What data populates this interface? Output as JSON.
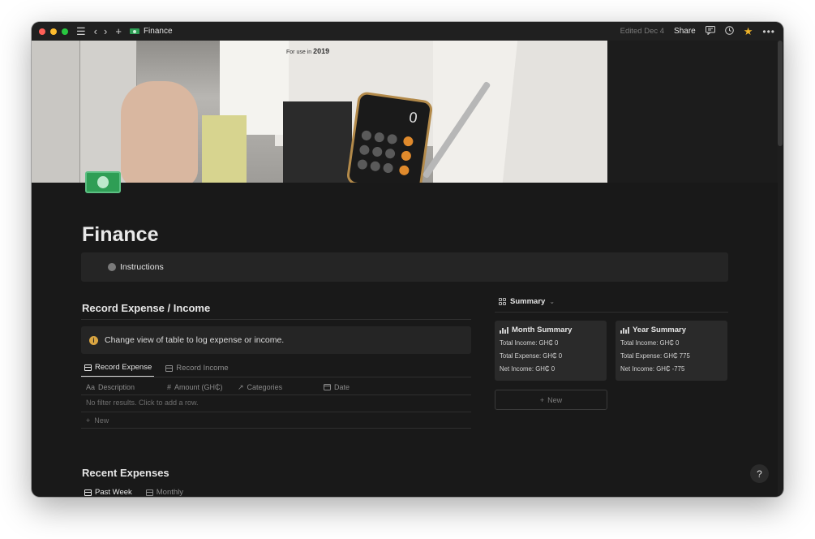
{
  "titlebar": {
    "page_name": "Finance",
    "edited": "Edited Dec 4",
    "share": "Share"
  },
  "cover": {
    "form_text": "For use in",
    "form_year": "2019",
    "calculator_display": "0"
  },
  "page": {
    "title": "Finance",
    "instructions_label": "Instructions"
  },
  "record_section": {
    "heading": "Record Expense / Income",
    "callout": "Change view of table to log expense or income.",
    "tabs": [
      {
        "label": "Record Expense",
        "active": true
      },
      {
        "label": "Record Income",
        "active": false
      }
    ],
    "columns": [
      {
        "icon": "Aa",
        "label": "Description"
      },
      {
        "icon": "#",
        "label": "Amount (GH₵)"
      },
      {
        "icon": "↗",
        "label": "Categories"
      },
      {
        "icon": "calendar-icon",
        "label": "Date"
      }
    ],
    "empty_text": "No filter results. Click to add a row.",
    "new_row": "New"
  },
  "summary": {
    "view_label": "Summary",
    "cards": [
      {
        "title": "Month Summary",
        "lines": [
          "Total Income: GH₵ 0",
          "Total Expense: GH₵ 0",
          "Net Income: GH₵ 0"
        ]
      },
      {
        "title": "Year Summary",
        "lines": [
          "Total Income: GH₵ 0",
          "Total Expense: GH₵ 775",
          "Net Income: GH₵ -775"
        ]
      }
    ],
    "new_label": "New"
  },
  "recent": {
    "heading": "Recent Expenses",
    "tabs": [
      {
        "label": "Past Week",
        "active": true
      },
      {
        "label": "Monthly",
        "active": false
      }
    ]
  },
  "help": "?",
  "colors": {
    "background": "#191919",
    "titlebar": "#202020",
    "callout": "#252525",
    "card": "#2a2a2a",
    "money_green": "#2f9e55",
    "star": "#f0b429",
    "info": "#d9a441"
  }
}
